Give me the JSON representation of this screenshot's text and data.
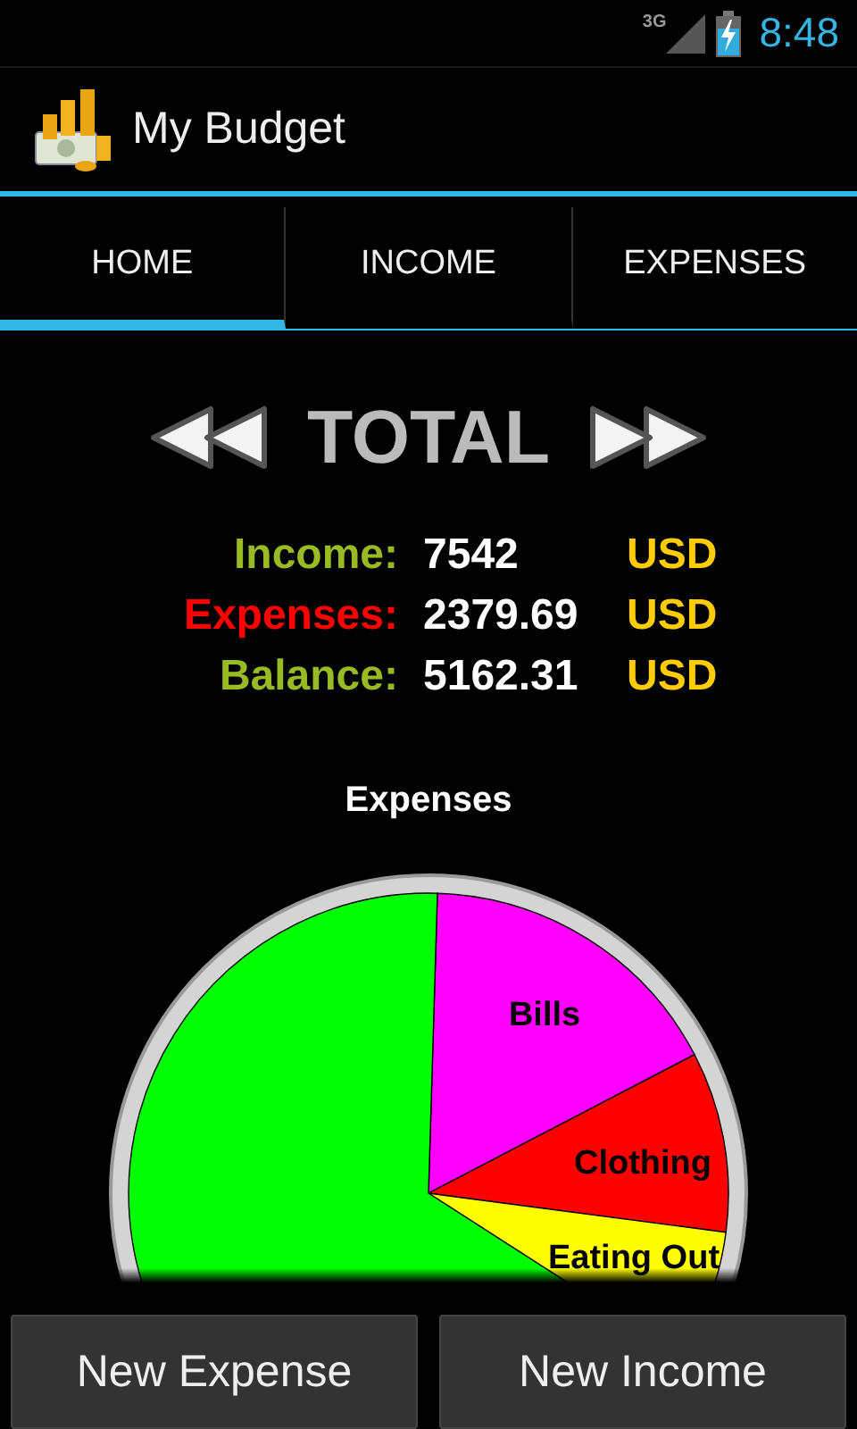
{
  "status_bar": {
    "network": "3G",
    "time": "8:48"
  },
  "action_bar": {
    "title": "My Budget"
  },
  "tabs": [
    {
      "label": "HOME",
      "selected": true
    },
    {
      "label": "INCOME",
      "selected": false
    },
    {
      "label": "EXPENSES",
      "selected": false
    }
  ],
  "period": {
    "title": "TOTAL"
  },
  "totals": [
    {
      "label": "Income:",
      "value": "7542",
      "currency": "USD",
      "color": "#99bb22"
    },
    {
      "label": "Expenses:",
      "value": "2379.69",
      "currency": "USD",
      "color": "#ff0000"
    },
    {
      "label": "Balance:",
      "value": "5162.31",
      "currency": "USD",
      "color": "#99bb22"
    }
  ],
  "chart": {
    "title": "Expenses",
    "slices": [
      {
        "label": "Bills",
        "color": "#ff00ff"
      },
      {
        "label": "Clothing",
        "color": "#ff0000"
      },
      {
        "label": "Eating Out",
        "color": "#ffff00"
      },
      {
        "color": "#00ff00"
      }
    ]
  },
  "buttons": [
    "New Expense",
    "New Income"
  ]
}
